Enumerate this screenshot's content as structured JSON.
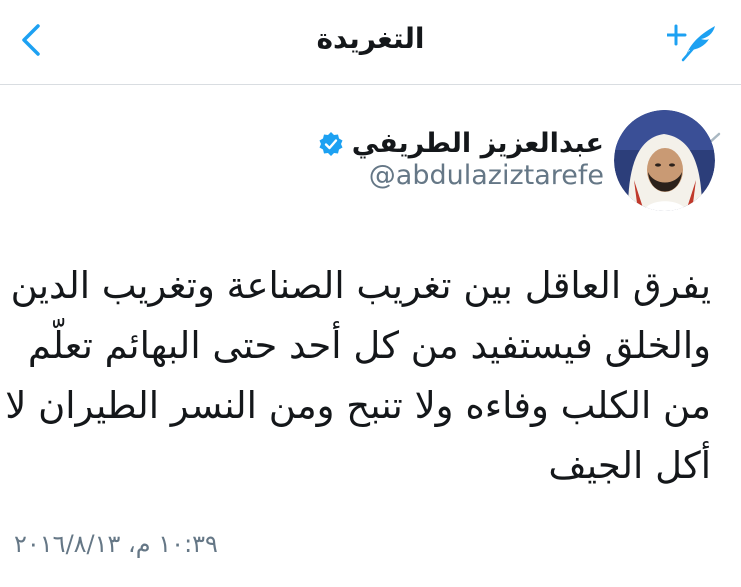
{
  "navbar": {
    "title": "التغريدة",
    "back_icon": "chevron-left-icon",
    "compose_icon": "compose-tweet-icon",
    "accent": "#1da1f2"
  },
  "author": {
    "name": "عبدالعزيز الطريفي",
    "handle": "@abdulaziztarefe",
    "verified": true,
    "verified_icon": "verified-badge-icon"
  },
  "tweet": {
    "lines": [
      "يفرق العاقل بين تغريب الصناعة وتغريب الدين",
      "والخلق فيستفيد من كل أحد حتى البهائم تعلّم",
      "من الكلب وفاءه ولا تنبح ومن النسر الطيران لا",
      "أكل الجيف"
    ],
    "timestamp": "١٠:٣٩ م، ٢٠١٦/٨/١٣",
    "menu_icon": "chevron-down-icon"
  },
  "colors": {
    "text": "#14171a",
    "secondary": "#657786",
    "divider": "#d9dde1",
    "accent": "#1da1f2"
  }
}
